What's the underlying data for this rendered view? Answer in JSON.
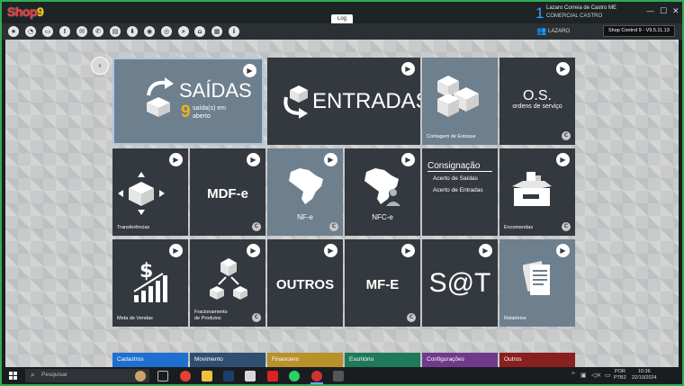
{
  "app": {
    "logo": "Shop9",
    "window_title": "Log"
  },
  "company": {
    "number": "1",
    "name": "Lazaro Correia de Castro ME",
    "subtitle": "COMERCIAL CASTRO"
  },
  "window_controls": {
    "minimize": "—",
    "restore": "☐",
    "close": "✕"
  },
  "toolbar": {
    "icons": [
      "star-icon",
      "dashboard-icon",
      "monitor-icon",
      "alert-icon",
      "mail-icon",
      "whatsapp-icon",
      "folder-icon",
      "download-icon",
      "eye-icon",
      "instagram-icon",
      "search-icon",
      "bank-icon",
      "calendar-icon",
      "info-icon"
    ],
    "user": "LAZARO",
    "version": "Shop Control 9 - V9.5.11.13"
  },
  "tiles": {
    "saidas": {
      "title": "SAÍDAS",
      "count": "9",
      "count_caption_1": "saída(s) em",
      "count_caption_2": "aberto"
    },
    "entradas": {
      "title": "ENTRADAS"
    },
    "estoque": {
      "label": "Contagem de Estoque"
    },
    "os": {
      "title": "O.S.",
      "subtitle": "ordens de serviço",
      "badge": "C"
    },
    "transferencias": {
      "label": "Transferências"
    },
    "mdfe": {
      "title": "MDF-e",
      "badge": "C"
    },
    "nfe": {
      "label": "NF-e",
      "badge": "C"
    },
    "nfce": {
      "label": "NFC-e"
    },
    "consignacao": {
      "title": "Consignação",
      "item1": "Acerto de Saídas",
      "item2": "Acerto de Entradas"
    },
    "encomendas": {
      "label": "Encomendas",
      "badge": "C"
    },
    "meta": {
      "label": "Meta de Vendas"
    },
    "fracionamento": {
      "label_1": "Fracionamento",
      "label_2": "de Produtos",
      "badge": "C"
    },
    "outros": {
      "title": "OUTROS"
    },
    "mfe": {
      "title": "MF-E",
      "badge": "C"
    },
    "sat": {
      "title": "S@T"
    },
    "relatorios": {
      "label": "Relatórios"
    }
  },
  "bottom_tabs": [
    {
      "label": "Cadastros",
      "color": "#1f6fd1"
    },
    {
      "label": "Movimento",
      "color": "#2f4f70"
    },
    {
      "label": "Financeiro",
      "color": "#b8912a"
    },
    {
      "label": "Escritório",
      "color": "#1e7a58"
    },
    {
      "label": "Configurações",
      "color": "#6f3a8c"
    },
    {
      "label": "Outros",
      "color": "#8a1f1f"
    }
  ],
  "taskbar": {
    "search_placeholder": "Pesquisar",
    "lang_1": "POR",
    "lang_2": "PTB2",
    "time": "10:36",
    "date": "22/10/2024"
  }
}
